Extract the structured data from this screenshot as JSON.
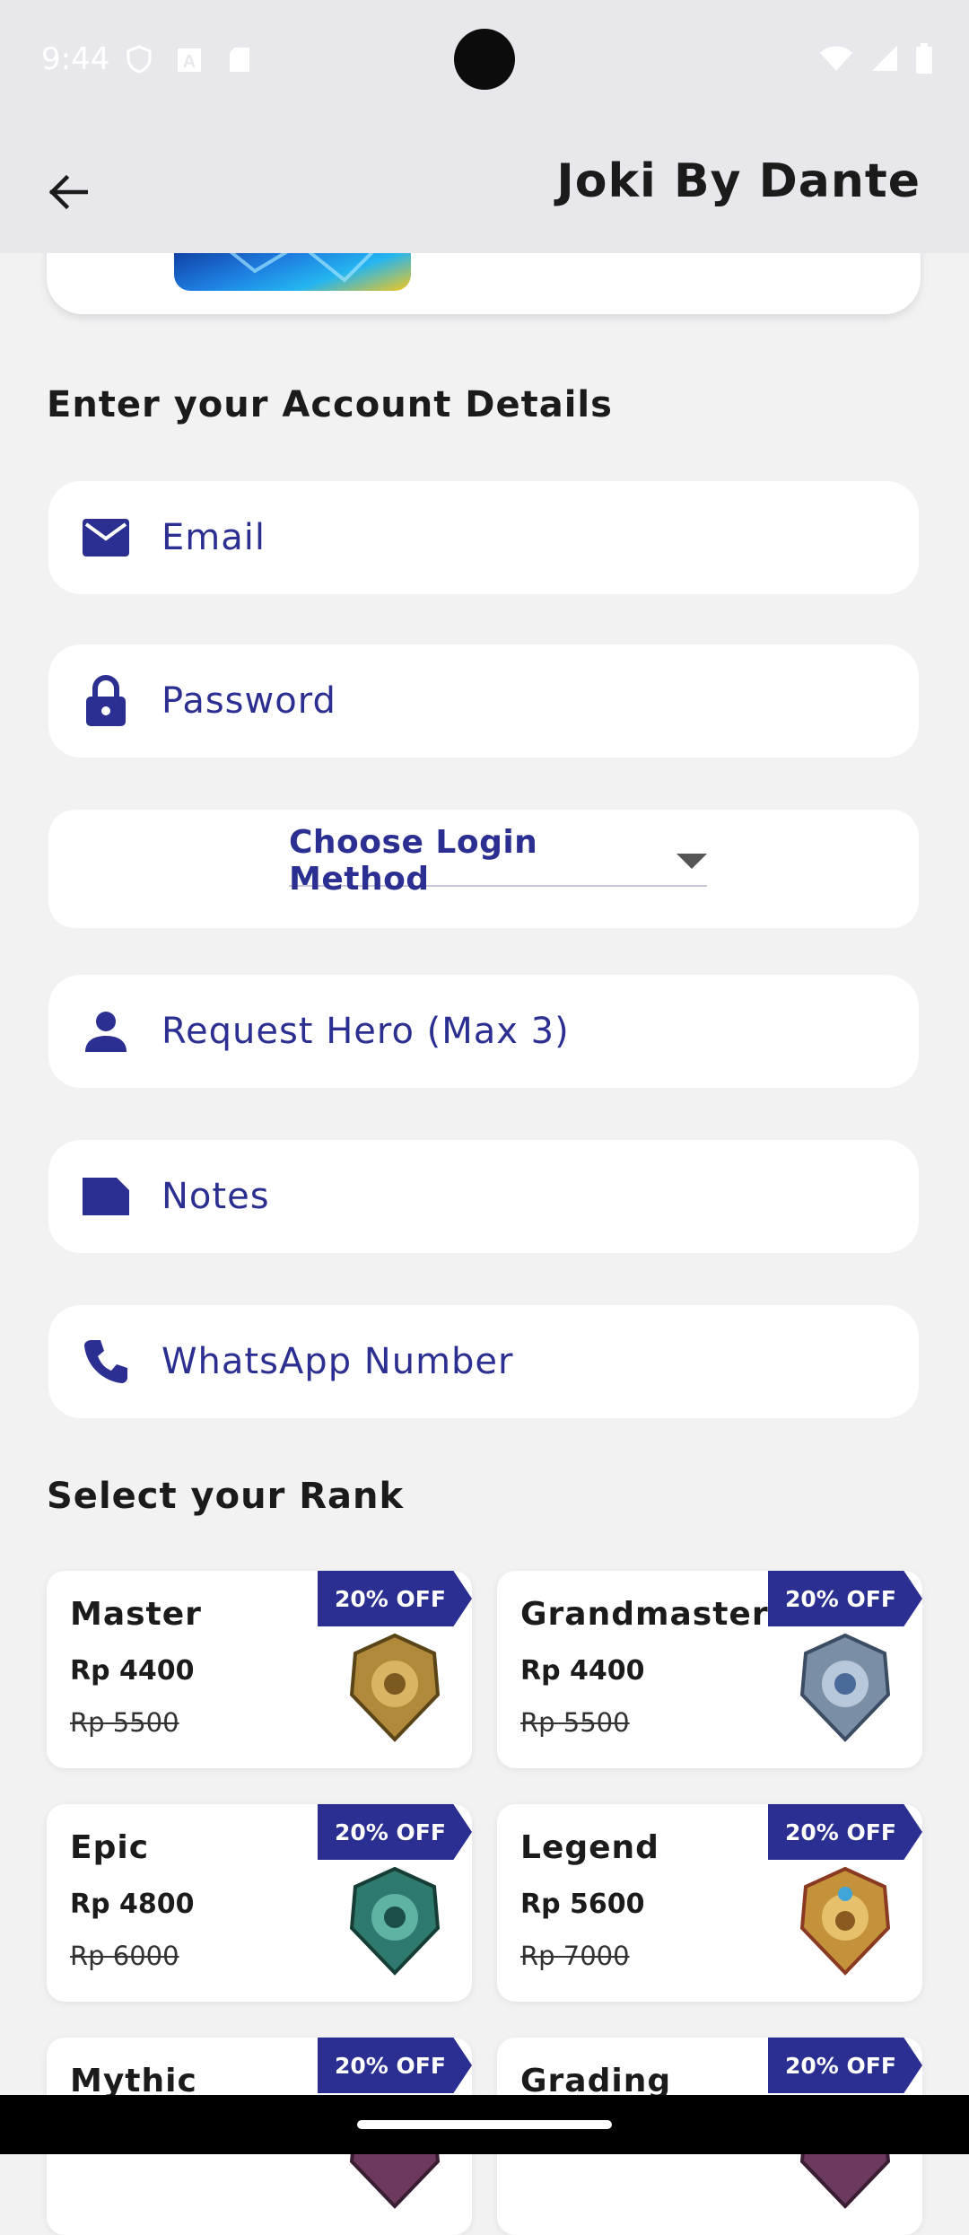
{
  "status": {
    "time": "9:44"
  },
  "app": {
    "title": "Joki By Dante"
  },
  "account": {
    "section_title": "Enter your Account Details",
    "email_placeholder": "Email",
    "password_placeholder": "Password",
    "login_method_label": "Choose Login Method",
    "hero_placeholder": "Request Hero (Max 3)",
    "notes_placeholder": "Notes",
    "whatsapp_placeholder": "WhatsApp Number"
  },
  "rank": {
    "section_title": "Select your Rank",
    "items": [
      {
        "name": "Master",
        "price": "Rp 4400",
        "old_price": "Rp 5500",
        "badge": "20% OFF",
        "emblem_color": "#b08a3a"
      },
      {
        "name": "Grandmaster",
        "price": "Rp 4400",
        "old_price": "Rp 5500",
        "badge": "20% OFF",
        "emblem_color": "#7a8ea6"
      },
      {
        "name": "Epic",
        "price": "Rp 4800",
        "old_price": "Rp 6000",
        "badge": "20% OFF",
        "emblem_color": "#2f7a6e"
      },
      {
        "name": "Legend",
        "price": "Rp 5600",
        "old_price": "Rp 7000",
        "badge": "20% OFF",
        "emblem_color": "#c4923a"
      },
      {
        "name": "Mythic",
        "price": "",
        "old_price": "",
        "badge": "20% OFF",
        "emblem_color": "#6b3a5e"
      },
      {
        "name": "Grading",
        "price": "",
        "old_price": "",
        "badge": "20% OFF",
        "emblem_color": "#6b3a5e"
      }
    ]
  },
  "colors": {
    "accent": "#2b2f91",
    "background": "#f2f2f3",
    "appbar": "#e8e8ec"
  }
}
